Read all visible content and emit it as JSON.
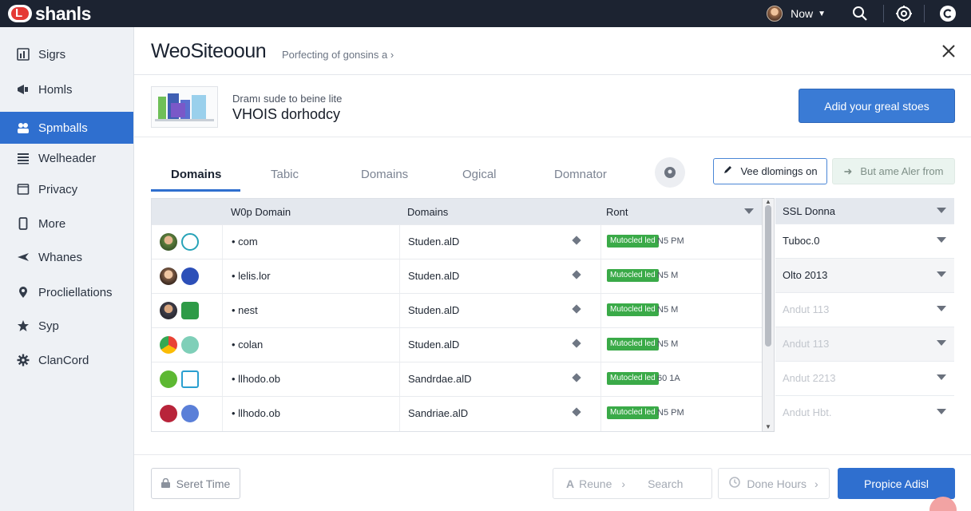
{
  "app": {
    "logo_mark": "L",
    "name": "shanls"
  },
  "topbar": {
    "user_label": "Now"
  },
  "sidebar": {
    "items": [
      {
        "label": "Sigrs",
        "icon": "bar-chart-icon",
        "active": false
      },
      {
        "label": "Homls",
        "icon": "megaphone-icon",
        "active": false
      },
      {
        "label": "Spmballs",
        "icon": "people-icon",
        "active": true
      },
      {
        "label": "Welheader",
        "icon": "list-icon",
        "active": false
      },
      {
        "label": "Privacy",
        "icon": "folder-icon",
        "active": false
      },
      {
        "label": "More",
        "icon": "phone-icon",
        "active": false
      },
      {
        "label": "Whanes",
        "icon": "plane-icon",
        "active": false
      },
      {
        "label": "Procliellations",
        "icon": "location-pin-icon",
        "active": false
      },
      {
        "label": "Syp",
        "icon": "star-icon",
        "active": false
      },
      {
        "label": "ClanCord",
        "icon": "gear-icon",
        "active": false
      }
    ]
  },
  "main": {
    "title": "WeoSiteooun",
    "breadcrumb": "Porfecting of gonsins a ›",
    "info": {
      "subtitle": "Dramı sude to beine lite",
      "title": "VHOIS dorhodcy"
    },
    "cta_label": "Adid your greal stoes",
    "tabs": [
      "Domains",
      "Tabic",
      "Domains",
      "Ogical",
      "Domnator"
    ],
    "view_button": "Vee dlomings on",
    "ghost_button": "But ame Aler from"
  },
  "table": {
    "headers": {
      "domain": "W0p Domain",
      "domains": "Domains",
      "ront": "Ront",
      "ssl": "SSL Donna"
    },
    "rows": [
      {
        "domain": "• com",
        "owner": "Studen.alD",
        "badge": "Mutocled led",
        "size": "N5 PM",
        "ssl": "Tuboc.0",
        "ssl_dim": false
      },
      {
        "domain": "• lelis.lor",
        "owner": "Studen.alD",
        "badge": "Mutocled led",
        "size": "N5 M",
        "ssl": "Olto 2013",
        "ssl_dim": false
      },
      {
        "domain": "• nest",
        "owner": "Studen.alD",
        "badge": "Mutocled led",
        "size": "N5 M",
        "ssl": "Andut 113",
        "ssl_dim": true
      },
      {
        "domain": "• colan",
        "owner": "Studen.alD",
        "badge": "Mutocled led",
        "size": "N5 M",
        "ssl": "Andut 113",
        "ssl_dim": true
      },
      {
        "domain": "• llhodo.ob",
        "owner": "Sandrdae.alD",
        "badge": "Mutocled led",
        "size": "60 1A",
        "ssl": "Andut 2213",
        "ssl_dim": true
      },
      {
        "domain": "• llhodo.ob",
        "owner": "Sandriae.alD",
        "badge": "Mutocled led",
        "size": "N5 PM",
        "ssl": "Andut Hbt.",
        "ssl_dim": true
      }
    ]
  },
  "footer": {
    "reset_label": "Seret Time",
    "resume_label": "Reune",
    "search_label": "Search",
    "done_label": "Done Hours",
    "primary_label": "Propice Adisl"
  },
  "colors": {
    "accent": "#2f6fcf",
    "topbar": "#1c2331",
    "badge": "#3aaa48"
  }
}
